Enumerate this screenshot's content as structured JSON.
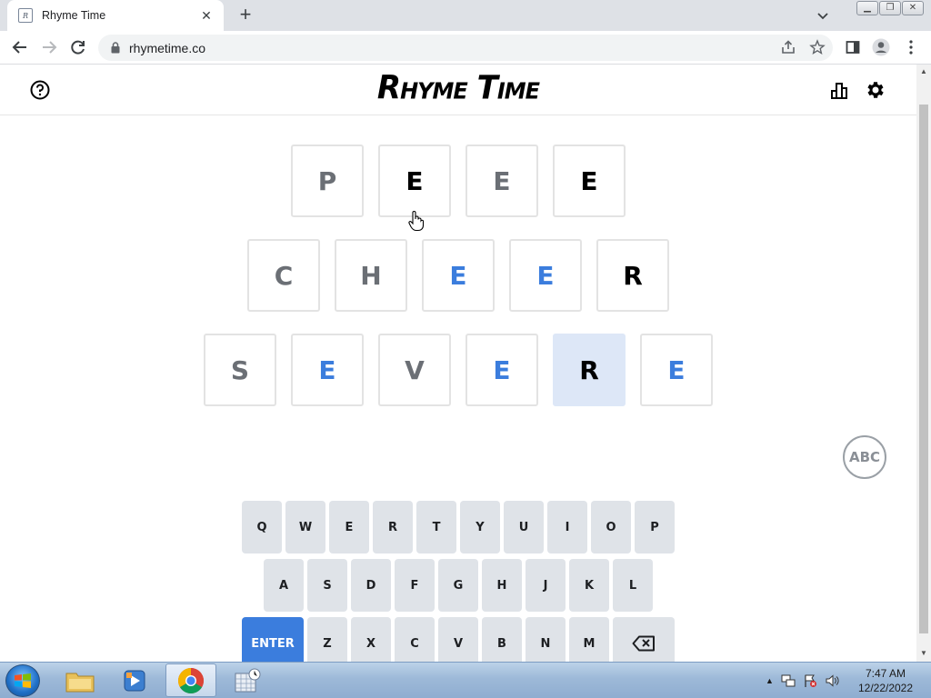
{
  "browser": {
    "tab_title": "Rhyme Time",
    "favicon_text": "R",
    "url": "rhymetime.co",
    "new_tab": "+",
    "tab_close": "✕"
  },
  "app": {
    "logo": "Rhyme Time",
    "abc_label": "ABC"
  },
  "grid": {
    "row1": [
      {
        "letter": "P",
        "color": "gray"
      },
      {
        "letter": "E",
        "color": "black"
      },
      {
        "letter": "E",
        "color": "gray"
      },
      {
        "letter": "E",
        "color": "black"
      }
    ],
    "row2": [
      {
        "letter": "C",
        "color": "gray"
      },
      {
        "letter": "H",
        "color": "gray"
      },
      {
        "letter": "E",
        "color": "blue"
      },
      {
        "letter": "E",
        "color": "blue"
      },
      {
        "letter": "R",
        "color": "black"
      }
    ],
    "row3": [
      {
        "letter": "S",
        "color": "gray"
      },
      {
        "letter": "E",
        "color": "blue"
      },
      {
        "letter": "V",
        "color": "gray"
      },
      {
        "letter": "E",
        "color": "blue"
      },
      {
        "letter": "R",
        "color": "black",
        "active": true
      },
      {
        "letter": "E",
        "color": "blue"
      }
    ]
  },
  "keyboard": {
    "row1": [
      "Q",
      "W",
      "E",
      "R",
      "T",
      "Y",
      "U",
      "I",
      "O",
      "P"
    ],
    "row2": [
      "A",
      "S",
      "D",
      "F",
      "G",
      "H",
      "J",
      "K",
      "L"
    ],
    "row3": [
      "ENTER",
      "Z",
      "X",
      "C",
      "V",
      "B",
      "N",
      "M",
      "⌫"
    ]
  },
  "taskbar": {
    "time": "7:47 AM",
    "date": "12/22/2022"
  },
  "colors": {
    "accent_blue": "#3b7ddd",
    "active_tile": "#dde7f7",
    "key_bg": "#dfe3e8"
  }
}
